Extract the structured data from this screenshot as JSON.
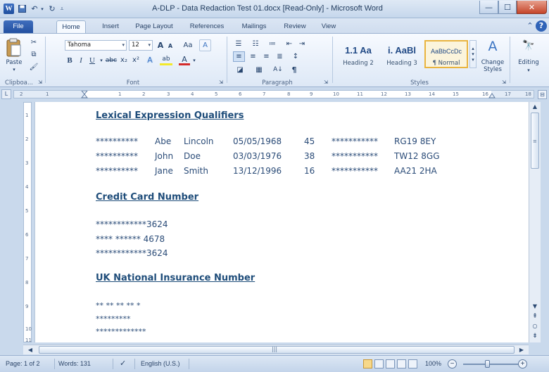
{
  "window": {
    "title": "A-DLP - Data Redaction Test 01.docx [Read-Only] - Microsoft Word",
    "app_icon": "W",
    "minimize": "—",
    "maximize": "☐",
    "close": "✕"
  },
  "quick_access": {
    "save_icon": "save-icon",
    "undo_icon": "undo-icon",
    "redo_icon": "redo-icon"
  },
  "tabs": [
    "File",
    "Home",
    "Insert",
    "Page Layout",
    "References",
    "Mailings",
    "Review",
    "View"
  ],
  "ribbon": {
    "clipboard": {
      "paste_label": "Paste",
      "group_label": "Clipboa..."
    },
    "font": {
      "font_name": "Tahoma",
      "font_size": "12",
      "grow": "A",
      "shrink": "A",
      "change_case": "Aa",
      "clear": "A",
      "bold": "B",
      "italic": "I",
      "underline": "U",
      "strike": "abc",
      "subscript": "x₂",
      "superscript": "x²",
      "text_effects": "A",
      "highlight": "ab",
      "font_color": "A",
      "group_label": "Font"
    },
    "paragraph": {
      "group_label": "Paragraph",
      "pilcrow": "¶",
      "sort": "A↓"
    },
    "styles": {
      "items": [
        {
          "preview": "1.1 Aa",
          "name": "Heading 2"
        },
        {
          "preview": "i. AaBl",
          "name": "Heading 3"
        },
        {
          "preview": "AaBbCcDc",
          "name": "¶ Normal"
        }
      ],
      "change_styles": "Change Styles",
      "group_label": "Styles"
    },
    "editing": {
      "label": "Editing"
    }
  },
  "ruler": {
    "corner": "L",
    "numbers": [
      "2",
      "1",
      "1",
      "2",
      "3",
      "4",
      "5",
      "6",
      "7",
      "8",
      "9",
      "10",
      "11",
      "12",
      "13",
      "14",
      "15",
      "16",
      "17",
      "18"
    ],
    "vertical_numbers": [
      "1",
      "2",
      "3",
      "4",
      "5",
      "6",
      "7",
      "8",
      "9",
      "10",
      "11"
    ]
  },
  "document": {
    "sections": [
      {
        "heading": "Lexical Expression Qualifiers",
        "rows": [
          {
            "mask": "**********",
            "first": "Abe",
            "last": "Lincoln",
            "date": "05/05/1968",
            "age": "45",
            "mask2": "***********",
            "postcode": "RG19 8EY"
          },
          {
            "mask": "**********",
            "first": "John",
            "last": "Doe",
            "date": "03/03/1976",
            "age": "38",
            "mask2": "***********",
            "postcode": "TW12 8GG"
          },
          {
            "mask": "**********",
            "first": "Jane",
            "last": "Smith",
            "date": "13/12/1996",
            "age": "16",
            "mask2": "***********",
            "postcode": "AA21 2HA"
          }
        ]
      },
      {
        "heading": "Credit Card Number",
        "lines": [
          "************3624",
          "**** ****** 4678",
          "************3624"
        ]
      },
      {
        "heading": "UK National Insurance Number",
        "lines": [
          "** ** ** ** *",
          "*********",
          "*************"
        ]
      }
    ]
  },
  "status_bar": {
    "page": "Page: 1 of 2",
    "words": "Words: 131",
    "language": "English (U.S.)",
    "zoom": "100%",
    "zoom_out": "−",
    "zoom_in": "+"
  },
  "colors": {
    "accent": "#2b579a",
    "document_text": "#2b4c78",
    "heading_text": "#1f4d7a",
    "chrome": "#c9d9ec"
  }
}
